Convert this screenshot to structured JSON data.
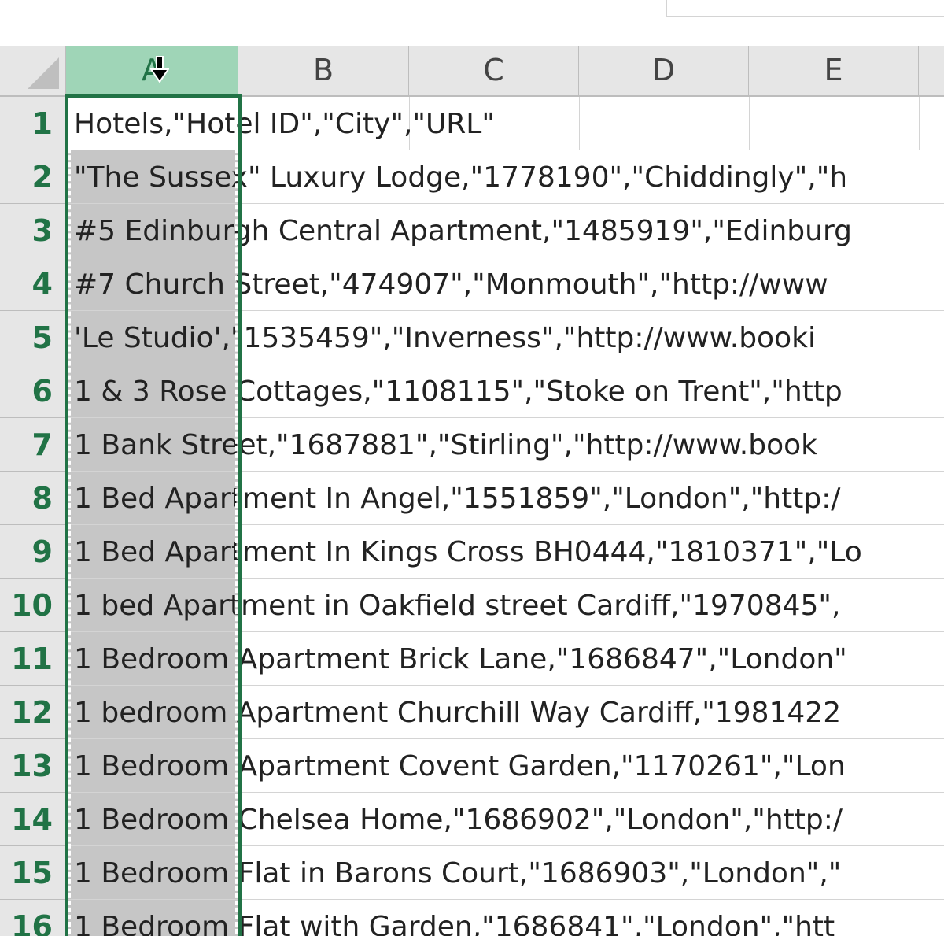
{
  "columns": [
    {
      "label": "A",
      "selected": true
    },
    {
      "label": "B",
      "selected": false
    },
    {
      "label": "C",
      "selected": false
    },
    {
      "label": "D",
      "selected": false
    },
    {
      "label": "E",
      "selected": false
    }
  ],
  "rows": [
    {
      "number": "1",
      "text": "Hotels,\"Hotel ID\",\"City\",\"URL\""
    },
    {
      "number": "2",
      "text": "\"The Sussex\" Luxury Lodge,\"1778190\",\"Chiddingly\",\"h"
    },
    {
      "number": "3",
      "text": "#5 Edinburgh Central Apartment,\"1485919\",\"Edinburg"
    },
    {
      "number": "4",
      "text": "#7 Church Street,\"474907\",\"Monmouth\",\"http://www"
    },
    {
      "number": "5",
      "text": "'Le Studio',\"1535459\",\"Inverness\",\"http://www.booki"
    },
    {
      "number": "6",
      "text": "1 & 3 Rose Cottages,\"1108115\",\"Stoke on Trent\",\"http"
    },
    {
      "number": "7",
      "text": "1 Bank Street,\"1687881\",\"Stirling\",\"http://www.book"
    },
    {
      "number": "8",
      "text": "1 Bed Apartment In Angel,\"1551859\",\"London\",\"http:/"
    },
    {
      "number": "9",
      "text": "1 Bed Apartment In Kings Cross BH0444,\"1810371\",\"Lo"
    },
    {
      "number": "10",
      "text": "1 bed Apartment in Oakfield street Cardiff,\"1970845\","
    },
    {
      "number": "11",
      "text": "1 Bedroom Apartment Brick Lane,\"1686847\",\"London\""
    },
    {
      "number": "12",
      "text": "1 bedroom Apartment Churchill Way Cardiff,\"1981422"
    },
    {
      "number": "13",
      "text": "1 Bedroom Apartment Covent Garden,\"1170261\",\"Lon"
    },
    {
      "number": "14",
      "text": "1 Bedroom Chelsea Home,\"1686902\",\"London\",\"http:/"
    },
    {
      "number": "15",
      "text": "1 Bedroom Flat in Barons Court,\"1686903\",\"London\",\""
    },
    {
      "number": "16",
      "text": "1 Bedroom Flat with Garden,\"1686841\",\"London\",\"htt"
    }
  ],
  "icons": {
    "column_select_cursor": "down-arrow-icon",
    "select_all": "select-all-triangle-icon"
  },
  "colors": {
    "accent": "#217346",
    "selected_header": "#9fd5b7",
    "selected_column_fill": "#c6c6c6",
    "header_bg": "#e6e6e6",
    "gridline": "#d4d4d4"
  }
}
